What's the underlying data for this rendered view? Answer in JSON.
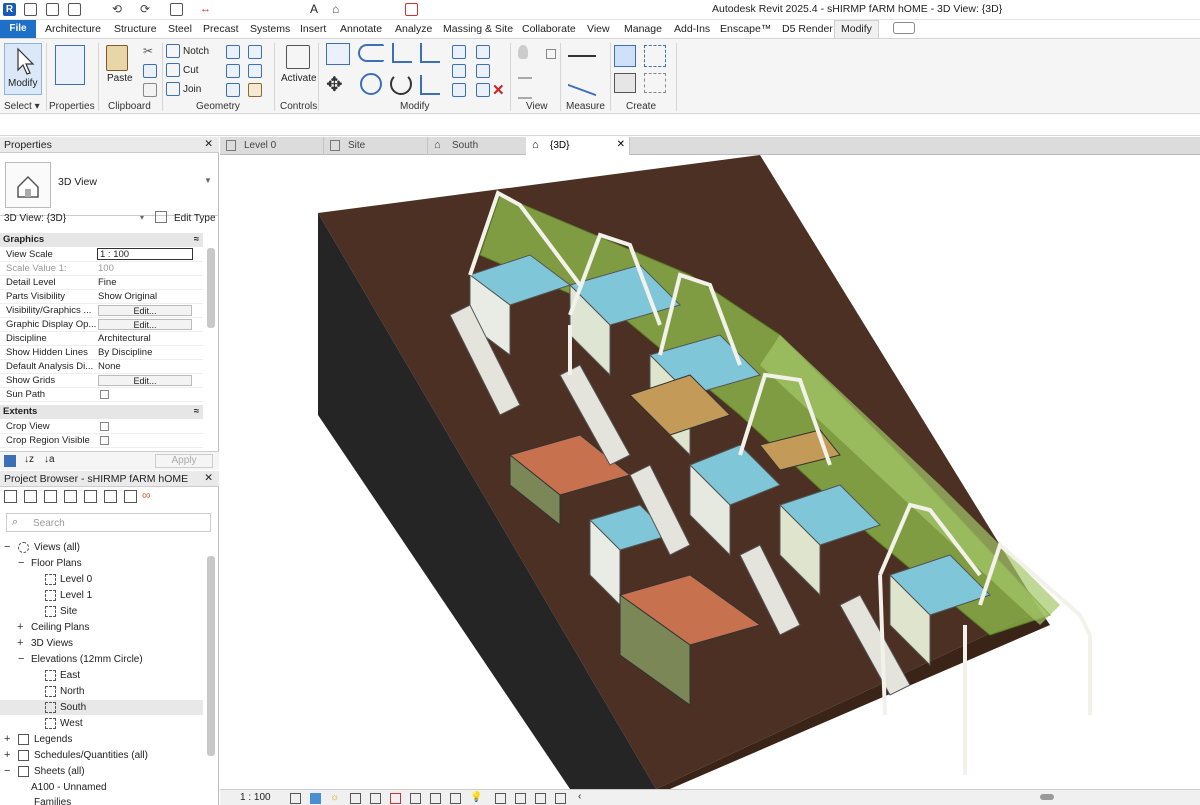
{
  "window": {
    "title": "Autodesk Revit 2025.4 - sHIRMP fARM hOME - 3D View: {3D}"
  },
  "ribbon_tabs": [
    "File",
    "Architecture",
    "Structure",
    "Steel",
    "Precast",
    "Systems",
    "Insert",
    "Annotate",
    "Analyze",
    "Massing & Site",
    "Collaborate",
    "View",
    "Manage",
    "Add-Ins",
    "Enscape™",
    "D5 Render",
    "Modify"
  ],
  "ribbon": {
    "select": {
      "modify_label": "Modify",
      "panel": "Select ▾"
    },
    "properties": {
      "panel": "Properties"
    },
    "clipboard": {
      "paste": "Paste",
      "panel": "Clipboard"
    },
    "geometry": {
      "notch": "Notch",
      "cut": "Cut",
      "join": "Join",
      "panel": "Geometry"
    },
    "controls": {
      "activate": "Activate",
      "panel": "Controls"
    },
    "modify": {
      "panel": "Modify"
    },
    "view": {
      "panel": "View"
    },
    "measure": {
      "panel": "Measure"
    },
    "create": {
      "panel": "Create"
    }
  },
  "properties_palette": {
    "title": "Properties",
    "type_name": "3D View",
    "instance": "3D View: {3D}",
    "edit_type": "Edit Type",
    "sections": {
      "graphics": "Graphics",
      "extents": "Extents"
    },
    "rows": [
      {
        "k": "View Scale",
        "v": "1 : 100"
      },
      {
        "k": "Scale Value    1:",
        "v": "100"
      },
      {
        "k": "Detail Level",
        "v": "Fine"
      },
      {
        "k": "Parts Visibility",
        "v": "Show Original"
      },
      {
        "k": "Visibility/Graphics ...",
        "v": "Edit..."
      },
      {
        "k": "Graphic Display Op...",
        "v": "Edit..."
      },
      {
        "k": "Discipline",
        "v": "Architectural"
      },
      {
        "k": "Show Hidden Lines",
        "v": "By Discipline"
      },
      {
        "k": "Default Analysis Di...",
        "v": "None"
      },
      {
        "k": "Show Grids",
        "v": "Edit..."
      },
      {
        "k": "Sun Path",
        "v": ""
      },
      {
        "k": "Crop View",
        "v": ""
      },
      {
        "k": "Crop Region Visible",
        "v": ""
      }
    ],
    "apply": "Apply"
  },
  "project_browser": {
    "title": "Project Browser - sHIRMP fARM hOME",
    "search_placeholder": "Search",
    "tree": [
      "Views (all)",
      "Floor Plans",
      "Level 0",
      "Level 1",
      "Site",
      "Ceiling Plans",
      "3D Views",
      "Elevations (12mm Circle)",
      "East",
      "North",
      "South",
      "West",
      "Legends",
      "Schedules/Quantities (all)",
      "Sheets (all)",
      "A100 - Unnamed",
      "Families"
    ]
  },
  "view_tabs": [
    "Level 0",
    "Site",
    "South",
    "{3D}"
  ],
  "status": {
    "scale": "1 : 100"
  },
  "colors": {
    "accent": "#1e6fc8",
    "terrain": "#4a3124",
    "glass_green": "#7fb23a",
    "pool": "#7ec6d8",
    "deck": "#c8714f"
  }
}
